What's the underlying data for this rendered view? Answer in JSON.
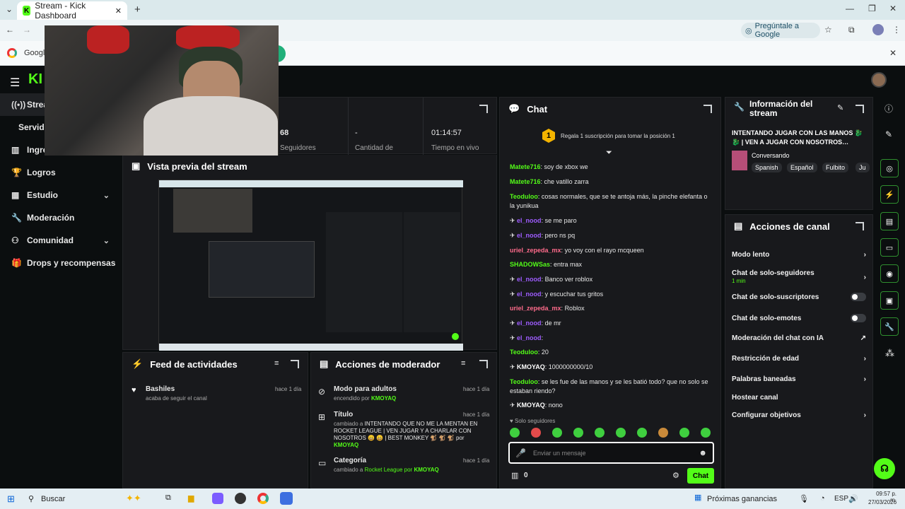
{
  "browser": {
    "tab_title": "Stream - Kick Dashboard",
    "ask_google": "Pregúntale a Google",
    "bookmark_google": "Google"
  },
  "nav": {
    "items": [
      {
        "label": "Stream"
      },
      {
        "label": "Servidor"
      },
      {
        "label": "Ingresos"
      },
      {
        "label": "Logros"
      },
      {
        "label": "Estudio"
      },
      {
        "label": "Moderación"
      },
      {
        "label": "Comunidad"
      },
      {
        "label": "Drops y recompensas"
      }
    ]
  },
  "stats": {
    "followers_value": "68",
    "followers_label": "Seguidores",
    "amount_value": "-",
    "amount_label": "Cantidad de",
    "time_value": "01:14:57",
    "time_label": "Tiempo en vivo"
  },
  "preview": {
    "title": "Vista previa del stream"
  },
  "feed": {
    "title": "Feed de actividades",
    "items": [
      {
        "user": "Bashiles",
        "time": "hace 1 día",
        "text": "acaba de seguir el canal"
      }
    ]
  },
  "modactions": {
    "title": "Acciones de moderador",
    "items": [
      {
        "title": "Modo para adultos",
        "time": "hace 1 día",
        "text": "encendido por",
        "by": "KMOYAQ"
      },
      {
        "title": "Título",
        "time": "hace 1 día",
        "text": "cambiado a",
        "value": "INTENTANDO QUE NO ME LA MENTAN EN ROCKET LEAGUE | VEN JUGAR Y A CHARLAR CON NOSOTROS 😄 😄 | BEST MONKEY 🐒 🐒 🐒 por",
        "by": "KMOYAQ"
      },
      {
        "title": "Categoría",
        "time": "hace 1 día",
        "text": "cambiado a",
        "value": "Rocket League por",
        "by": "KMOYAQ"
      }
    ]
  },
  "chat": {
    "title": "Chat",
    "gift_text": "Regala 1 suscripción para tomar la posición 1",
    "gift_rank": "1",
    "messages": [
      {
        "user": "Matete716",
        "text": "soy de xbox we",
        "color": "#53fc18"
      },
      {
        "user": "Matete716",
        "text": "che vatillo zarra",
        "color": "#53fc18"
      },
      {
        "user": "Teoduloo",
        "text": "cosas normales, que se te antoja más, la pinche elefanta o la yunikua",
        "color": "#53fc18"
      },
      {
        "user": "el_nood",
        "text": "se me paro",
        "color": "#9e5cff"
      },
      {
        "user": "el_nood",
        "text": "pero ns pq",
        "color": "#9e5cff"
      },
      {
        "user": "uriel_zepeda_mx",
        "text": "yo voy con el rayo mcqueen",
        "color": "#ff6b8b"
      },
      {
        "user": "SHADOWSas",
        "text": "entra max",
        "color": "#53fc18"
      },
      {
        "user": "el_nood",
        "text": "Banco ver roblox",
        "color": "#9e5cff"
      },
      {
        "user": "el_nood",
        "text": "y escuchar tus gritos",
        "color": "#9e5cff"
      },
      {
        "user": "uriel_zepeda_mx",
        "text": "Roblox",
        "color": "#ff6b8b"
      },
      {
        "user": "el_nood",
        "text": "de mr",
        "color": "#9e5cff"
      },
      {
        "user": "el_nood",
        "text": "",
        "color": "#9e5cff"
      },
      {
        "user": "Teoduloo",
        "text": "20",
        "color": "#53fc18"
      },
      {
        "user": "KMOYAQ",
        "text": "1000000000/10",
        "color": "#ffffff"
      },
      {
        "user": "Teoduloo",
        "text": "se les fue de las manos y se les batió todo? que no solo se estaban riendo?",
        "color": "#53fc18"
      },
      {
        "user": "KMOYAQ",
        "text": "nono",
        "color": "#ffffff"
      }
    ],
    "followers_only": "Solo seguidores",
    "input_placeholder": "Enviar un mensaje",
    "points": "0",
    "send_label": "Chat"
  },
  "info": {
    "title": "Información del stream",
    "stream_title": "INTENTANDO JUGAR CON LAS MANOS 🐉 🐉 | VEN A JUGAR CON NOSOTROS…",
    "category": "Conversando",
    "tags": [
      "Spanish",
      "Español",
      "Fulbito",
      "Ju"
    ]
  },
  "channel": {
    "title": "Acciones de canal",
    "items": [
      {
        "label": "Modo lento",
        "kind": "chev"
      },
      {
        "label": "Chat de solo-seguidores",
        "sub": "1 min",
        "kind": "chev"
      },
      {
        "label": "Chat de solo-suscriptores",
        "kind": "toggle"
      },
      {
        "label": "Chat de solo-emotes",
        "kind": "toggle"
      },
      {
        "label": "Moderación del chat con IA",
        "kind": "ext"
      },
      {
        "label": "Restricción de edad",
        "kind": "chev"
      },
      {
        "label": "Palabras baneadas",
        "kind": "chev"
      },
      {
        "label": "Hostear canal",
        "kind": "none"
      },
      {
        "label": "Configurar objetivos",
        "kind": "chev"
      }
    ]
  },
  "taskbar": {
    "search": "Buscar",
    "news": "Próximas ganancias",
    "lang": "ESP",
    "time": "09:57 p. m.",
    "date": "27/03/2026"
  }
}
